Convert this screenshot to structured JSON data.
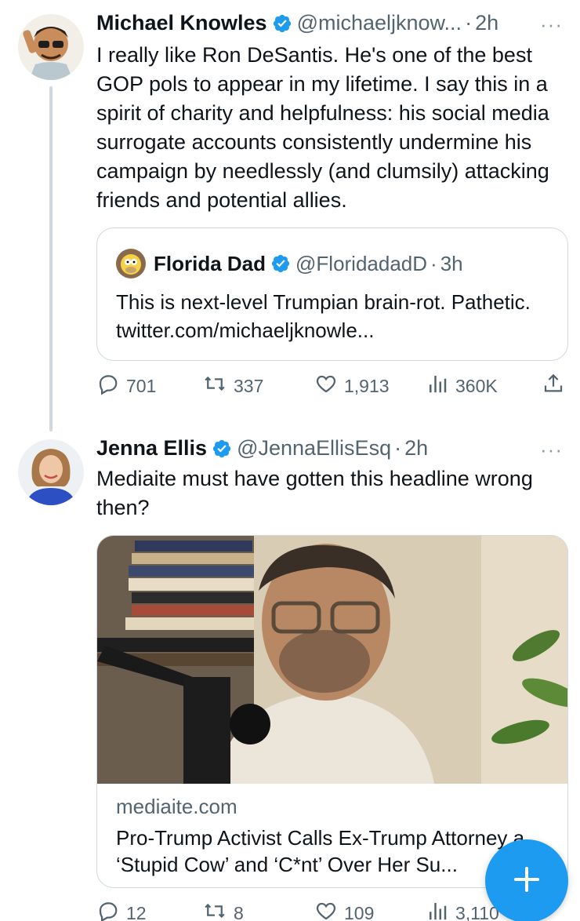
{
  "tweets": [
    {
      "author_name": "Michael Knowles",
      "handle": "@michaeljknow...",
      "dot": "·",
      "time": "2h",
      "more": "···",
      "text": "I really like Ron DeSantis. He's one of the best GOP pols to appear in my lifetime. I say this in a spirit of charity and helpfulness: his social media surrogate accounts consistently undermine his campaign by needlessly (and clumsily) attacking friends and potential allies.",
      "quote": {
        "author_name": "Florida Dad",
        "handle": "@FloridadadD",
        "dot": "·",
        "time": "3h",
        "text": "This is next-level Trumpian brain-rot. Pathetic. twitter.com/michaeljknowle..."
      },
      "actions": {
        "replies": "701",
        "retweets": "337",
        "likes": "1,913",
        "views": "360K"
      }
    },
    {
      "author_name": "Jenna Ellis",
      "handle": "@JennaEllisEsq",
      "dot": "·",
      "time": "2h",
      "more": "···",
      "text": "Mediaite must have gotten this headline wrong then?",
      "card": {
        "domain": "mediaite.com",
        "headline": "Pro-Trump Activist Calls Ex-Trump Attorney a ‘Stupid Cow’ and ‘C*nt’ Over Her Su..."
      },
      "actions": {
        "replies": "12",
        "retweets": "8",
        "likes": "109",
        "views": "3,110"
      }
    }
  ],
  "colors": {
    "accent": "#1d9bf0",
    "text": "#0f1419",
    "secondary": "#536471",
    "border": "#cfd9de"
  },
  "icons": {
    "verified": "verified-badge-icon",
    "reply": "reply-icon",
    "retweet": "retweet-icon",
    "like": "heart-icon",
    "views": "views-chart-icon",
    "share": "share-icon",
    "compose": "plus-icon"
  }
}
